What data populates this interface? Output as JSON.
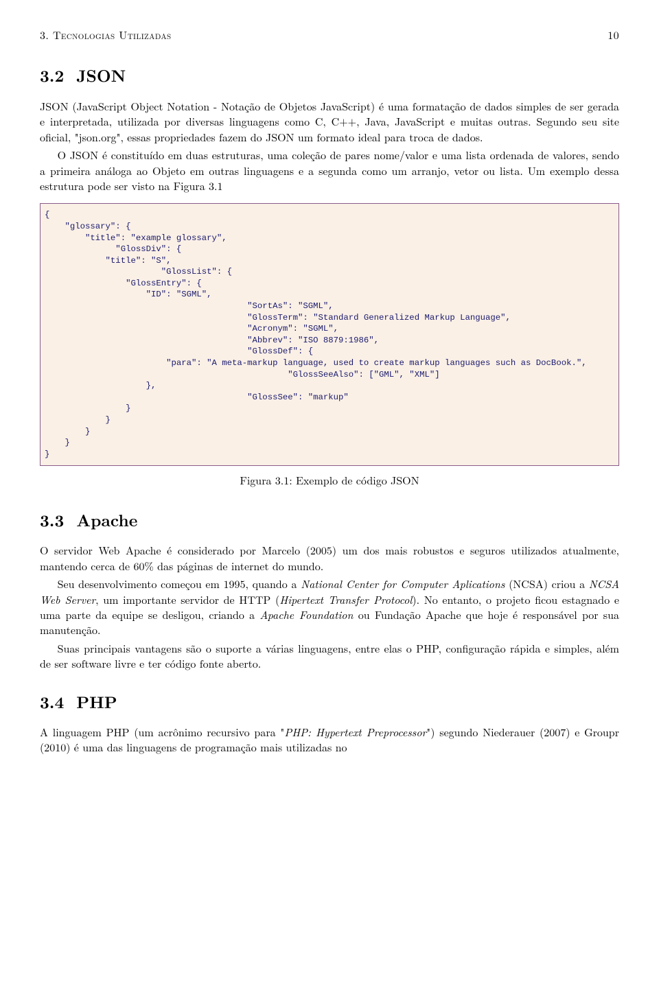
{
  "header": {
    "chapter": "3. Tecnologias Utilizadas",
    "page": "10"
  },
  "section32": {
    "heading_number": "3.2",
    "heading_title": "JSON",
    "para1": "JSON (JavaScript Object Notation - Notação de Objetos JavaScript) é uma formatação de dados simples de ser gerada e interpretada, utilizada por diversas linguagens como C, C++, Java, JavaScript e muitas outras. Segundo seu site oficial, \"json.org\", essas propriedades fazem do JSON um formato ideal para troca de dados.",
    "para2": "O JSON é constituído em duas estruturas, uma coleção de pares nome/valor e uma lista ordenada de valores, sendo a primeira análoga ao Objeto em outras linguagens e a segunda como um arranjo, vetor ou lista. Um exemplo dessa estrutura pode ser visto na Figura 3.1"
  },
  "code_figure": "{\n    \"glossary\": {\n        \"title\": \"example glossary\",\n              \"GlossDiv\": {\n            \"title\": \"S\",\n                       \"GlossList\": {\n                \"GlossEntry\": {\n                    \"ID\": \"SGML\",\n                                        \"SortAs\": \"SGML\",\n                                        \"GlossTerm\": \"Standard Generalized Markup Language\",\n                                        \"Acronym\": \"SGML\",\n                                        \"Abbrev\": \"ISO 8879:1986\",\n                                        \"GlossDef\": {\n                        \"para\": \"A meta-markup language, used to create markup languages such as DocBook.\",\n                                                \"GlossSeeAlso\": [\"GML\", \"XML\"]\n                    },\n                                        \"GlossSee\": \"markup\"\n                }\n            }\n        }\n    }\n}",
  "figure_caption": "Figura 3.1: Exemplo de código JSON",
  "section33": {
    "heading_number": "3.3",
    "heading_title": "Apache",
    "para1": "O servidor Web Apache é considerado por Marcelo (2005) um dos mais robustos e seguros utilizados atualmente, mantendo cerca de 60% das páginas de internet do mundo.",
    "para2a": "Seu desenvolvimento começou em 1995, quando a ",
    "para2b_italic": "National Center for Computer Aplications",
    "para2c": " (NCSA) criou a ",
    "para2d_italic": "NCSA Web Server",
    "para2e": ", um importante servidor de HTTP (",
    "para2f_italic": "Hipertext Transfer Protocol",
    "para2g": "). No entanto, o projeto ficou estagnado e uma parte da equipe se desligou, criando a ",
    "para2h_italic": "Apache Foundation",
    "para2i": " ou Fundação Apache que hoje é responsável por sua manutenção.",
    "para3": "Suas principais vantagens são o suporte a várias linguagens, entre elas o PHP, configuração rápida e simples, além de ser software livre e ter código fonte aberto."
  },
  "section34": {
    "heading_number": "3.4",
    "heading_title": "PHP",
    "para1a": "A linguagem PHP (um acrônimo recursivo para \"",
    "para1b_italic": "PHP: Hypertext Preprocessor",
    "para1c": "\") segundo Niederauer (2007) e Groupr (2010) é uma das linguagens de programação mais utilizadas no"
  }
}
